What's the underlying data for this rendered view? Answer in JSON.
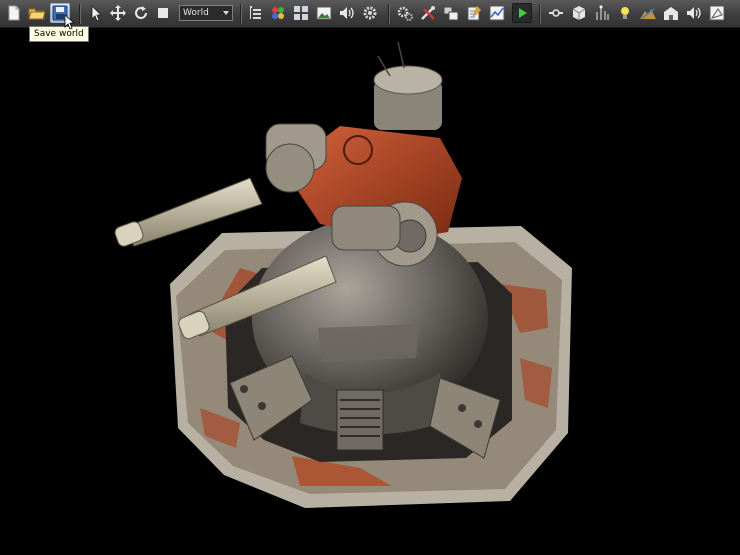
{
  "toolbar": {
    "icons": [
      "new-file-icon",
      "open-folder-icon",
      "save-icon",
      "select-arrow-icon",
      "move-icon",
      "rotate-icon",
      "scale-icon",
      "outliner-icon",
      "palette-icon",
      "grid-icon",
      "picture-icon",
      "sound-icon",
      "gear-icon",
      "gears-icon",
      "tools-icon",
      "windows-icon",
      "notepad-icon",
      "graph-icon",
      "play-icon",
      "link-icon",
      "cube-icon",
      "particles-icon",
      "light-icon",
      "terrain-icon",
      "house-icon",
      "speaker-icon",
      "sketch-icon"
    ],
    "coordinate_space": {
      "selected": "World"
    },
    "tooltip": "Save world"
  },
  "colors": {
    "toolbar": "#3e3e3e",
    "viewport_background": "#000000",
    "tooltip_background": "#ffffe1",
    "rust": "#b5451c",
    "metal": "#8a8680"
  },
  "viewport": {
    "scene_object": "turret-model-icon"
  }
}
